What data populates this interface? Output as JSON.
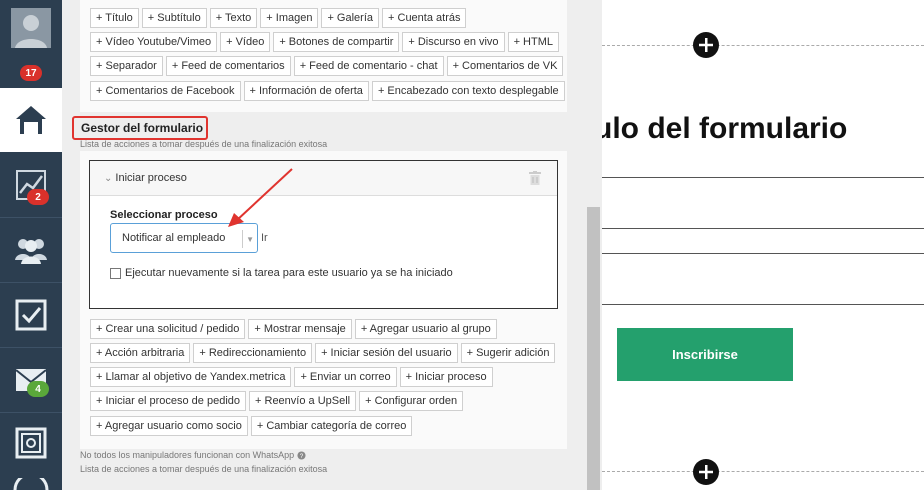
{
  "sidebar": {
    "notifications_badge": "17",
    "analytics_badge": "2",
    "mail_badge": "4"
  },
  "elements_toolbar": {
    "rows": [
      [
        "+ Título",
        "+ Subtítulo",
        "+ Texto",
        "+ Imagen",
        "+ Galería",
        "+ Cuenta atrás"
      ],
      [
        "+ Vídeo Youtube/Vimeo",
        "+ Vídeo",
        "+ Botones de compartir",
        "+ Discurso en vivo",
        "+ HTML"
      ],
      [
        "+ Separador",
        "+ Feed de comentarios",
        "+ Feed de comentario - chat",
        "+ Comentarios de VK"
      ],
      [
        "+ Comentarios de Facebook",
        "+ Información de oferta",
        "+ Encabezado con texto desplegable"
      ]
    ]
  },
  "form_handler": {
    "title": "Gestor del formulario",
    "hint": "Lista de acciones a tomar después de una finalización exitosa",
    "process_card": {
      "header": "Iniciar proceso",
      "select_label": "Seleccionar proceso",
      "select_value": "Notificar al empleado",
      "go_link": "Ir",
      "checkbox_label": "Ejecutar nuevamente si la tarea para este usuario ya se ha iniciado",
      "checkbox_checked": false
    },
    "action_rows": [
      [
        "+ Crear una solicitud / pedido",
        "+ Mostrar mensaje",
        "+ Agregar usuario al grupo"
      ],
      [
        "+ Acción arbitraria",
        "+ Redireccionamiento",
        "+ Iniciar sesión del usuario",
        "+ Sugerir adición"
      ],
      [
        "+ Llamar al objetivo de Yandex.metrica",
        "+ Enviar un correo",
        "+ Iniciar proceso"
      ],
      [
        "+ Iniciar el proceso de pedido",
        "+ Reenvío a UpSell",
        "+ Configurar orden"
      ],
      [
        "+ Agregar usuario como socio",
        "+ Cambiar categoría de correo"
      ]
    ],
    "whatsapp_note": "No todos los manipuladores funcionan con WhatsApp",
    "bottom_hint": "Lista de acciones a tomar después de una finalización exitosa"
  },
  "preview": {
    "form_title": "ulo del formulario",
    "subscribe_button": "Inscribirse",
    "accent_color": "#24a06d"
  },
  "colors": {
    "sidebar_bg": "#2c3e50",
    "highlight_red": "#e0342f",
    "badge_red": "#d9312b",
    "badge_green": "#5aa83a"
  }
}
